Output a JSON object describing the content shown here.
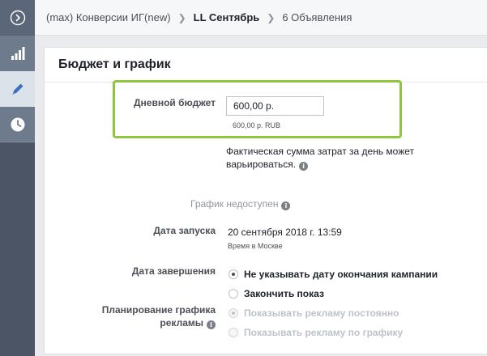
{
  "rail": {
    "items": [
      {
        "icon": "expand-icon"
      },
      {
        "icon": "chart-bars-icon"
      },
      {
        "icon": "pencil-icon"
      },
      {
        "icon": "clock-icon"
      }
    ]
  },
  "breadcrumb": {
    "campaign": "(max) Конверсии ИГ(new)",
    "adset": "LL Сентябрь",
    "ads": "6 Объявления"
  },
  "card": {
    "title": "Бюджет и график"
  },
  "budget": {
    "label": "Дневной бюджет",
    "value": "600,00 р.",
    "hint": "600,00 р. RUB",
    "note_line1": "Фактическая сумма затрат за день может",
    "note_line2": "варьироваться."
  },
  "schedule": {
    "unavailable": "График недоступен",
    "start_label": "Дата запуска",
    "start_value": "20 сентября 2018 г. 13:59",
    "timezone": "Время в Москве",
    "end_label": "Дата завершения",
    "end_options": [
      {
        "label": "Не указывать дату окончания кампании",
        "checked": true
      },
      {
        "label": "Закончить показ",
        "checked": false
      }
    ],
    "planning_label_line1": "Планирование графика",
    "planning_label_line2": "рекламы",
    "planning_options": [
      {
        "label": "Показывать рекламу постоянно",
        "checked": true,
        "disabled": true
      },
      {
        "label": "Показывать рекламу по графику",
        "checked": false,
        "disabled": true
      }
    ]
  },
  "colors": {
    "highlight": "#8dc63f",
    "rail": "#4b5566",
    "rail_active": "#dce2ea"
  }
}
